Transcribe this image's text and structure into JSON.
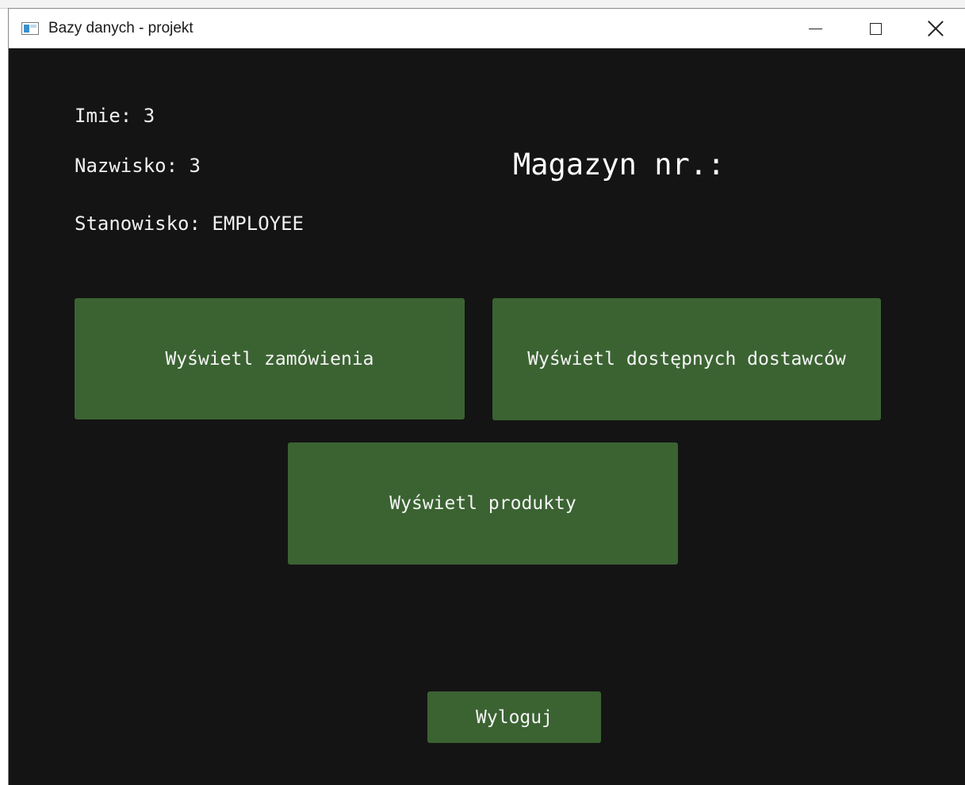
{
  "window": {
    "title": "Bazy danych - projekt"
  },
  "user": {
    "imie": "Imie: 3",
    "nazwisko": "Nazwisko: 3",
    "stanowisko": "Stanowisko: EMPLOYEE"
  },
  "warehouse": {
    "label": "Magazyn nr.:"
  },
  "actions": {
    "orders_label": "Wyświetl zamówienia",
    "suppliers_label": "Wyświetl dostępnych dostawców",
    "products_label": "Wyświetl produkty",
    "logout_label": "Wyloguj"
  },
  "icons": {
    "app": "app-window-icon",
    "minimize": "minimize-icon",
    "maximize": "maximize-icon",
    "close": "close-icon"
  },
  "colors": {
    "background": "#141414",
    "button": "#3b6332",
    "text": "#f0f0f0"
  }
}
